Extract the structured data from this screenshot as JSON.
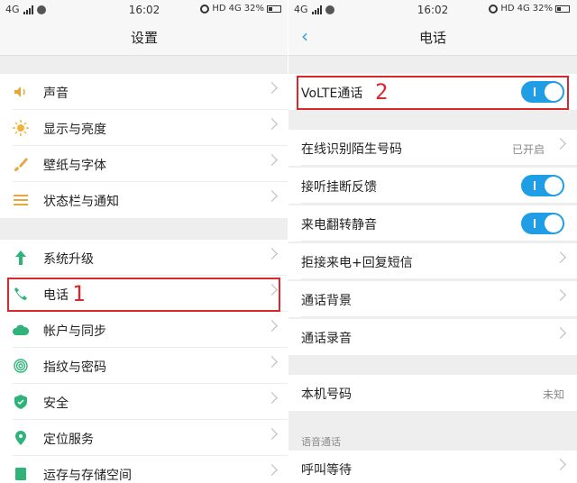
{
  "status_bar": {
    "network": "4G",
    "time": "16:02",
    "hd": "HD",
    "lte": "4G",
    "battery": "32%"
  },
  "left": {
    "title": "设置",
    "items": [
      {
        "label": "声音",
        "icon": "speaker-icon"
      },
      {
        "label": "显示与亮度",
        "icon": "sun-icon"
      },
      {
        "label": "壁纸与字体",
        "icon": "brush-icon"
      },
      {
        "label": "状态栏与通知",
        "icon": "list-icon"
      },
      {
        "label": "系统升级",
        "icon": "arrow-up-icon"
      },
      {
        "label": "电话",
        "icon": "phone-icon"
      },
      {
        "label": "帐户与同步",
        "icon": "cloud-icon"
      },
      {
        "label": "指纹与密码",
        "icon": "fingerprint-icon"
      },
      {
        "label": "安全",
        "icon": "shield-icon"
      },
      {
        "label": "定位服务",
        "icon": "location-pin-icon"
      },
      {
        "label": "运存与存储空间",
        "icon": "storage-icon"
      }
    ],
    "annotation": "1"
  },
  "right": {
    "title": "电话",
    "volte": {
      "label": "VoLTE通话",
      "on": true
    },
    "items": [
      {
        "label": "在线识别陌生号码",
        "value": "已开启"
      },
      {
        "label": "接听挂断反馈",
        "toggle": true
      },
      {
        "label": "来电翻转静音",
        "toggle": true
      },
      {
        "label": "拒接来电+回复短信"
      },
      {
        "label": "通话背景"
      },
      {
        "label": "通话录音"
      }
    ],
    "number": {
      "label": "本机号码",
      "value": "未知"
    },
    "section_voice": "语音通话",
    "call_waiting": "呼叫等待",
    "annotation": "2"
  },
  "colors": {
    "accent": "#1f9ee6",
    "highlight": "#d9272e"
  }
}
